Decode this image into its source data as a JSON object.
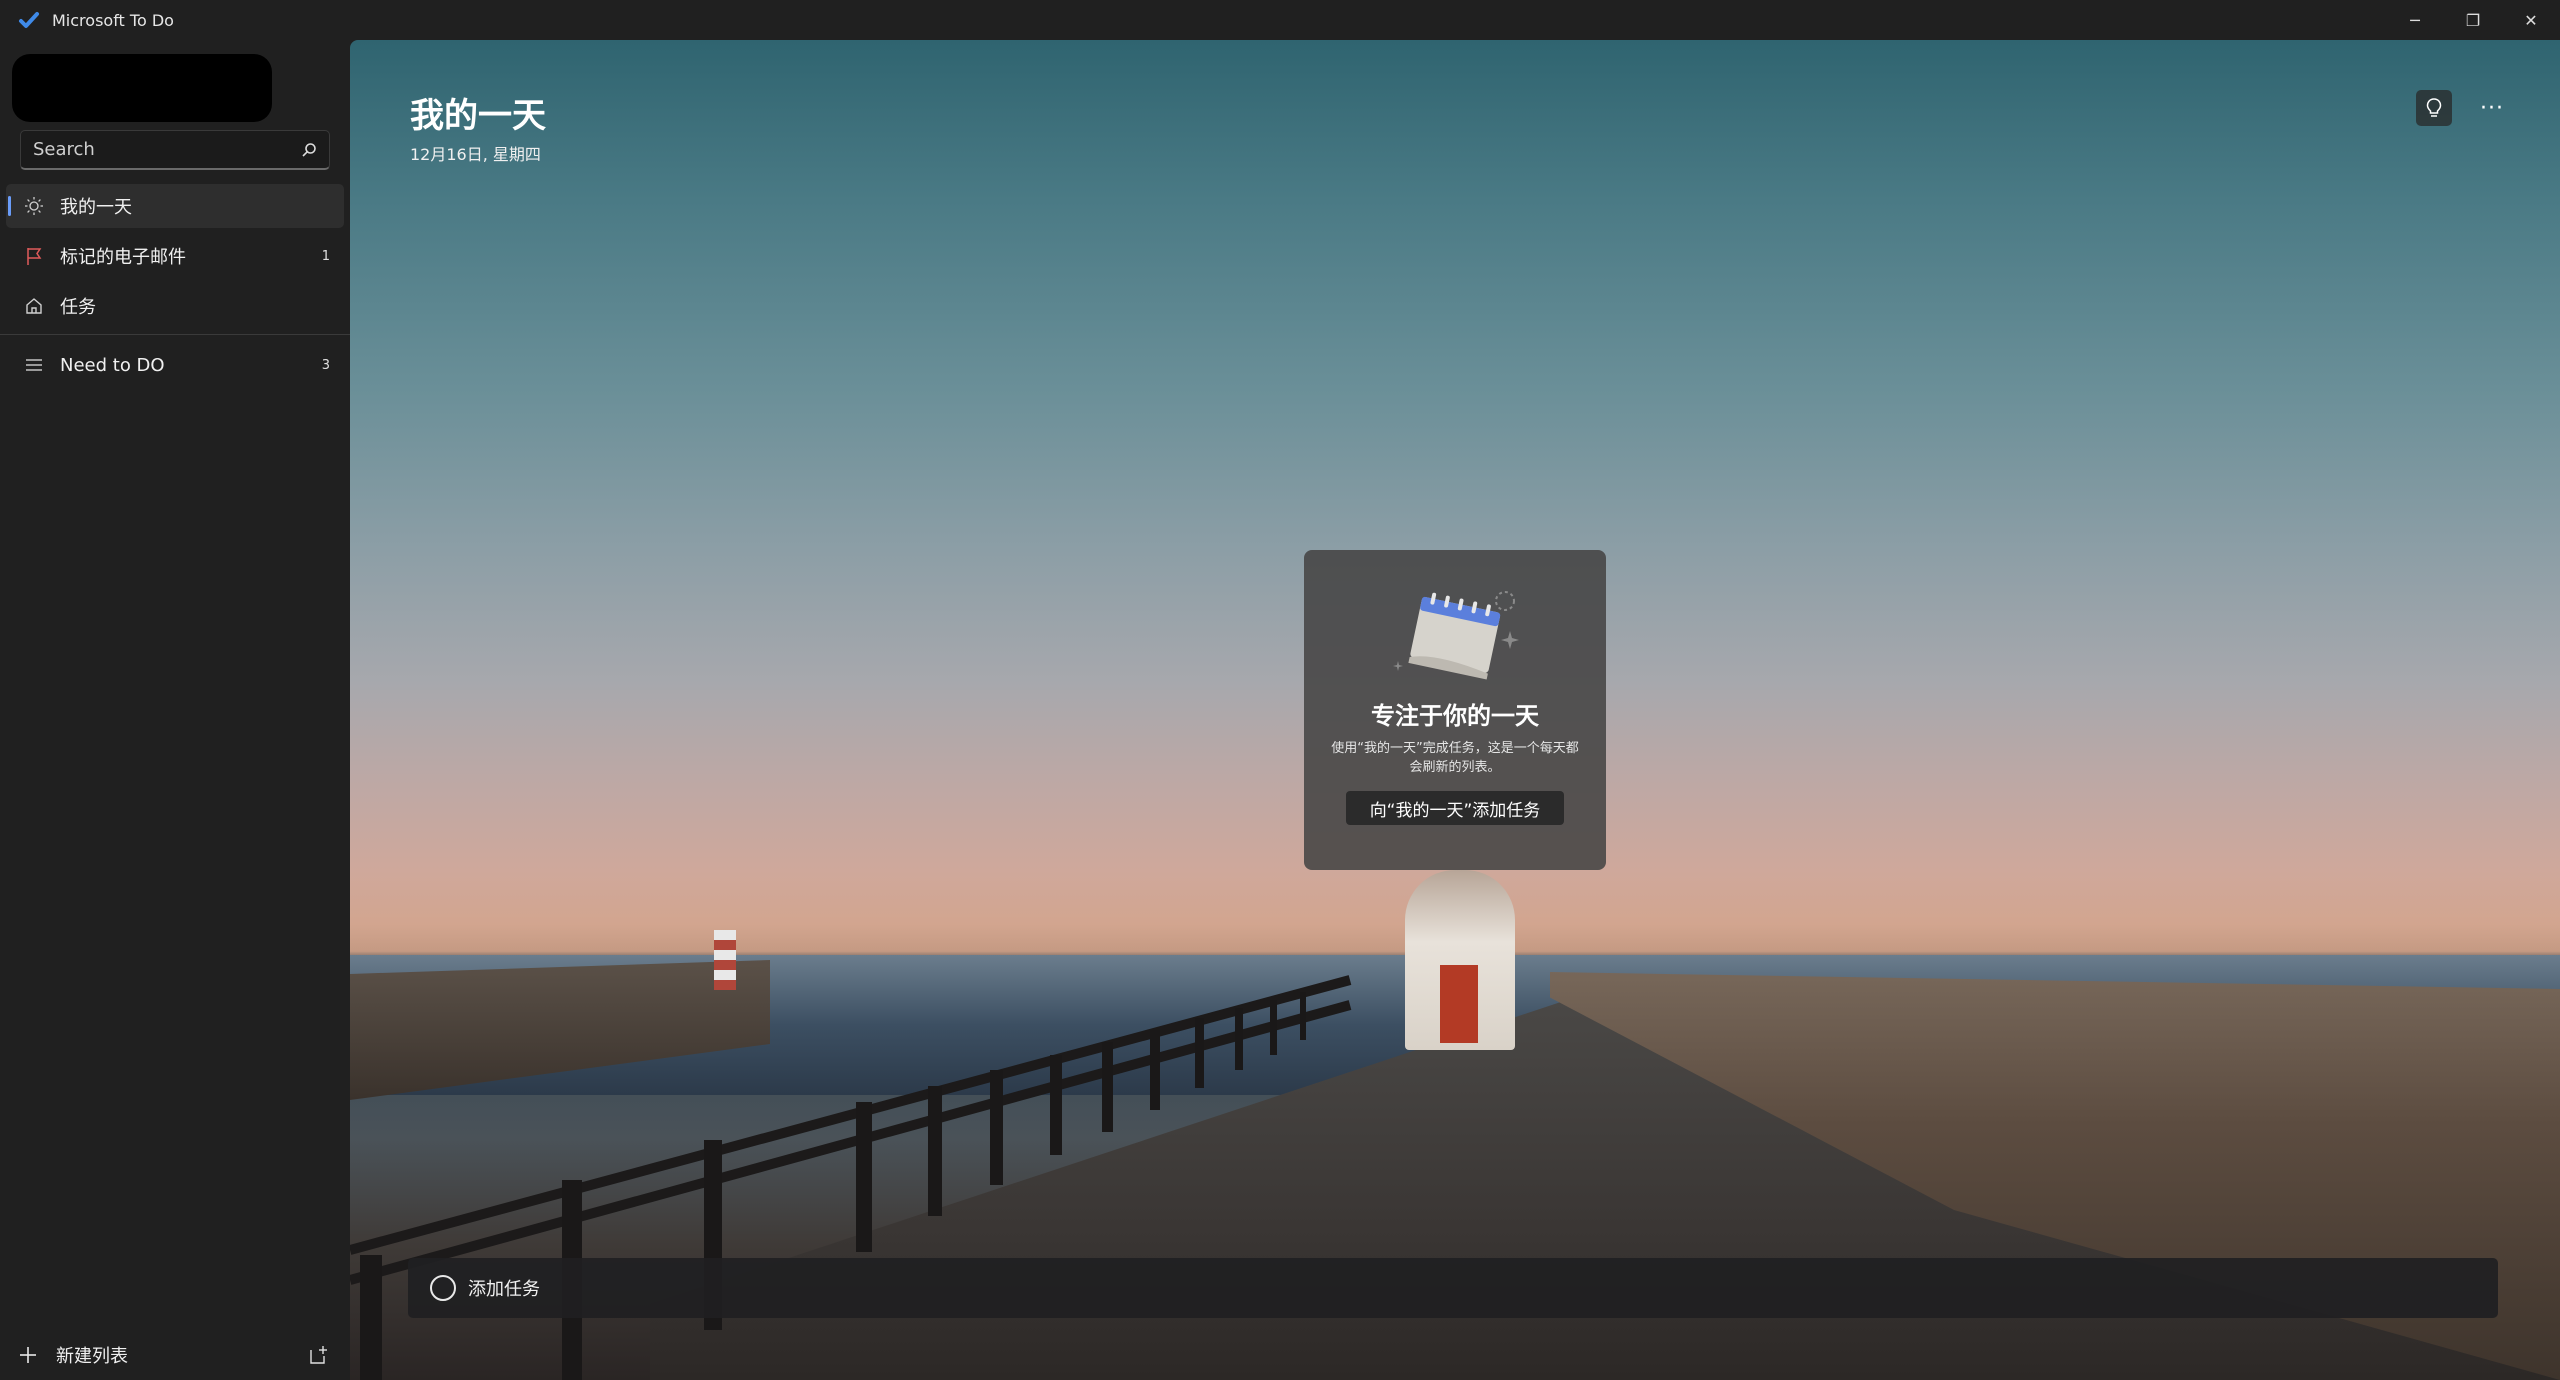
{
  "window": {
    "title": "Microsoft To Do",
    "minimize": "─",
    "restore": "❐",
    "close": "✕"
  },
  "search": {
    "placeholder": "Search"
  },
  "sidebar": {
    "items": [
      {
        "label": "我的一天",
        "icon": "sun-icon",
        "count": ""
      },
      {
        "label": "标记的电子邮件",
        "icon": "flag-icon",
        "count": "1"
      },
      {
        "label": "任务",
        "icon": "home-icon",
        "count": ""
      },
      {
        "label": "Need to DO",
        "icon": "list-icon",
        "count": "3"
      }
    ],
    "new_list_label": "新建列表"
  },
  "main": {
    "title": "我的一天",
    "date": "12月16日, 星期四",
    "more_label": "···",
    "card": {
      "title": "专注于你的一天",
      "description": "使用“我的一天”完成任务，这是一个每天都会刷新的列表。",
      "button": "向“我的一天”添加任务"
    },
    "add_task_label": "添加任务"
  },
  "colors": {
    "accent": "#6a9cf8",
    "flag": "#e05a5a",
    "sidebar_bg": "#202020"
  }
}
